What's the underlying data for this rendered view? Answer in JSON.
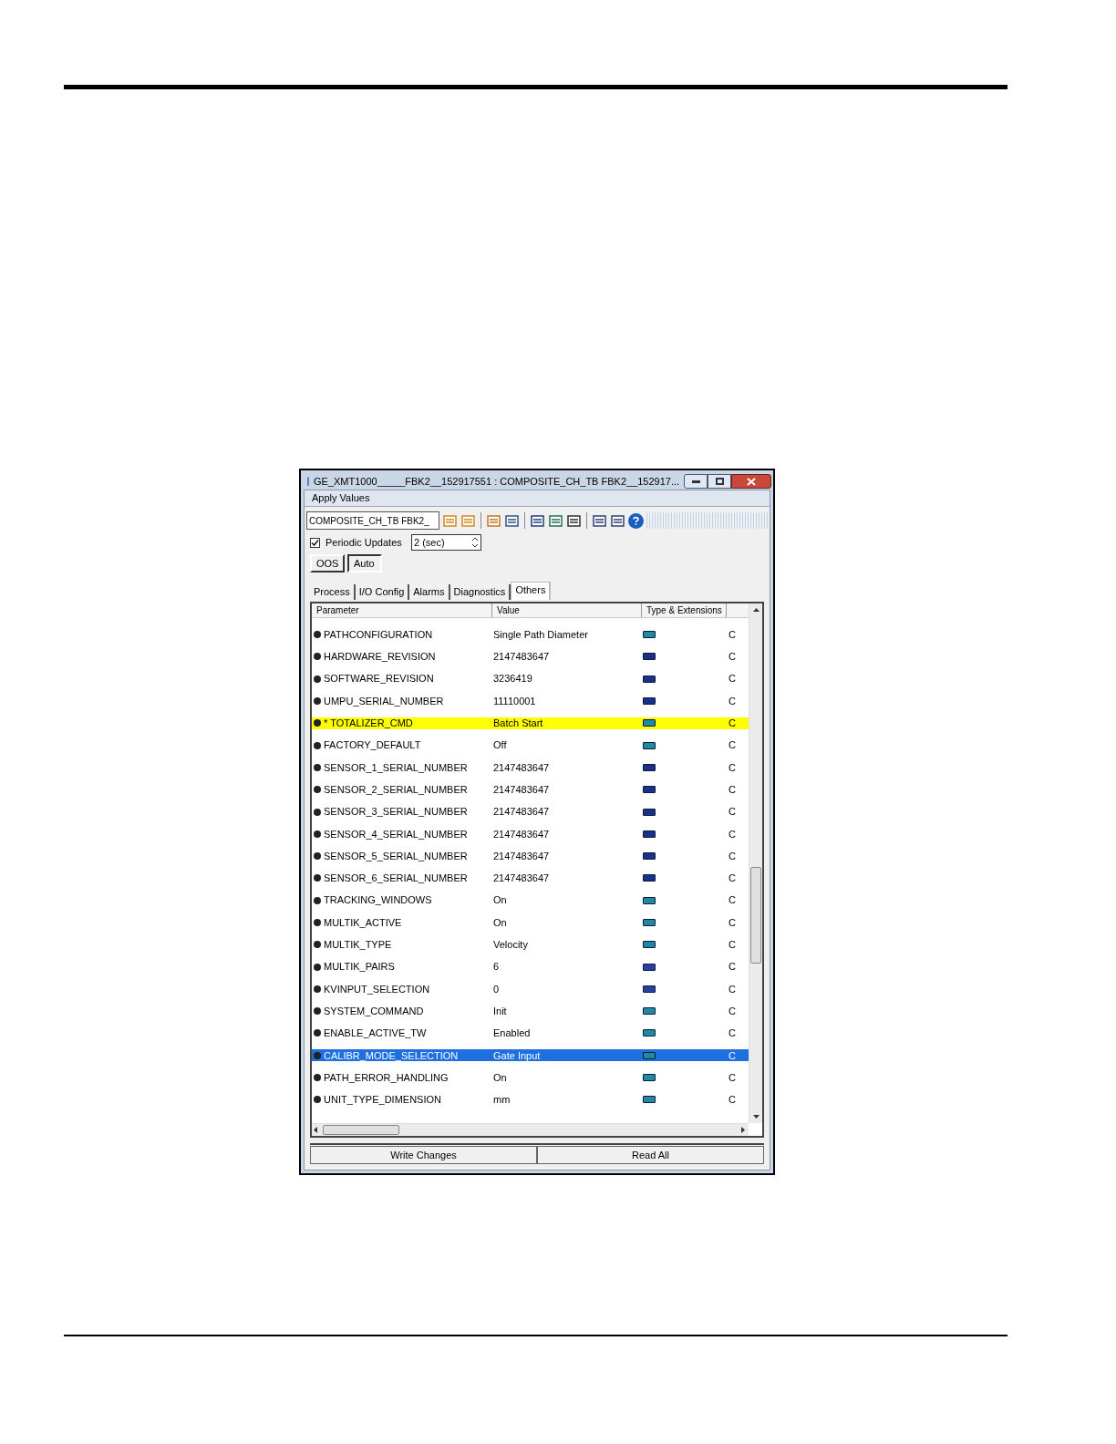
{
  "window": {
    "title": "GE_XMT1000_____FBK2__152917551 : COMPOSITE_CH_TB FBK2__152917..."
  },
  "menu": [
    "Apply Values"
  ],
  "toolbar": {
    "block": "COMPOSITE_CH_TB FBK2_"
  },
  "periodic_updates": {
    "label": "Periodic Updates",
    "checked": true,
    "interval": "2 (sec)"
  },
  "modes": [
    {
      "label": "OOS",
      "selected": false
    },
    {
      "label": "Auto",
      "selected": true
    }
  ],
  "tabs": [
    {
      "label": "Process",
      "selected": false
    },
    {
      "label": "I/O Config",
      "selected": false
    },
    {
      "label": "Alarms",
      "selected": false
    },
    {
      "label": "Diagnostics",
      "selected": false
    },
    {
      "label": "Others",
      "selected": true
    }
  ],
  "table": {
    "columns": [
      "Parameter",
      "Value",
      "Type & Extensions"
    ],
    "rows": [
      {
        "parameter": "PATHCONFIGURATION",
        "value": "Single Path Diameter",
        "kind": "enum",
        "column_4": "C",
        "modified": false,
        "selected": false
      },
      {
        "parameter": "HARDWARE_REVISION",
        "value": "2147483647",
        "kind": "u32",
        "column_4": "C",
        "modified": false,
        "selected": false
      },
      {
        "parameter": "SOFTWARE_REVISION",
        "value": "3236419",
        "kind": "u32",
        "column_4": "C",
        "modified": false,
        "selected": false
      },
      {
        "parameter": "UMPU_SERIAL_NUMBER",
        "value": "11110001",
        "kind": "u32",
        "column_4": "C",
        "modified": false,
        "selected": false
      },
      {
        "parameter": "* TOTALIZER_CMD",
        "value": "Batch Start",
        "kind": "enum",
        "column_4": "C",
        "modified": true,
        "selected": false
      },
      {
        "parameter": "FACTORY_DEFAULT",
        "value": "Off",
        "kind": "enum",
        "column_4": "C",
        "modified": false,
        "selected": false
      },
      {
        "parameter": "SENSOR_1_SERIAL_NUMBER",
        "value": "2147483647",
        "kind": "u32",
        "column_4": "C",
        "modified": false,
        "selected": false
      },
      {
        "parameter": "SENSOR_2_SERIAL_NUMBER",
        "value": "2147483647",
        "kind": "u32",
        "column_4": "C",
        "modified": false,
        "selected": false
      },
      {
        "parameter": "SENSOR_3_SERIAL_NUMBER",
        "value": "2147483647",
        "kind": "u32",
        "column_4": "C",
        "modified": false,
        "selected": false
      },
      {
        "parameter": "SENSOR_4_SERIAL_NUMBER",
        "value": "2147483647",
        "kind": "u32",
        "column_4": "C",
        "modified": false,
        "selected": false
      },
      {
        "parameter": "SENSOR_5_SERIAL_NUMBER",
        "value": "2147483647",
        "kind": "u32",
        "column_4": "C",
        "modified": false,
        "selected": false
      },
      {
        "parameter": "SENSOR_6_SERIAL_NUMBER",
        "value": "2147483647",
        "kind": "u32",
        "column_4": "C",
        "modified": false,
        "selected": false
      },
      {
        "parameter": "TRACKING_WINDOWS",
        "value": "On",
        "kind": "enum",
        "column_4": "C",
        "modified": false,
        "selected": false
      },
      {
        "parameter": "MULTIK_ACTIVE",
        "value": "On",
        "kind": "enum",
        "column_4": "C",
        "modified": false,
        "selected": false
      },
      {
        "parameter": "MULTIK_TYPE",
        "value": "Velocity",
        "kind": "enum",
        "column_4": "C",
        "modified": false,
        "selected": false
      },
      {
        "parameter": "MULTIK_PAIRS",
        "value": "6",
        "kind": "u8",
        "column_4": "C",
        "modified": false,
        "selected": false
      },
      {
        "parameter": "KVINPUT_SELECTION",
        "value": "0",
        "kind": "u8",
        "column_4": "C",
        "modified": false,
        "selected": false
      },
      {
        "parameter": "SYSTEM_COMMAND",
        "value": "Init",
        "kind": "enum",
        "column_4": "C",
        "modified": false,
        "selected": false
      },
      {
        "parameter": "ENABLE_ACTIVE_TW",
        "value": "Enabled",
        "kind": "enum",
        "column_4": "C",
        "modified": false,
        "selected": false
      },
      {
        "parameter": "CALIBR_MODE_SELECTION",
        "value": "Gate Input",
        "kind": "enum",
        "column_4": "C",
        "modified": false,
        "selected": true
      },
      {
        "parameter": "PATH_ERROR_HANDLING",
        "value": "On",
        "kind": "enum",
        "column_4": "C",
        "modified": false,
        "selected": false
      },
      {
        "parameter": "UNIT_TYPE_DIMENSION",
        "value": "mm",
        "kind": "enum",
        "column_4": "C",
        "modified": false,
        "selected": false
      }
    ]
  },
  "buttons": [
    "Write Changes",
    "Read All"
  ]
}
